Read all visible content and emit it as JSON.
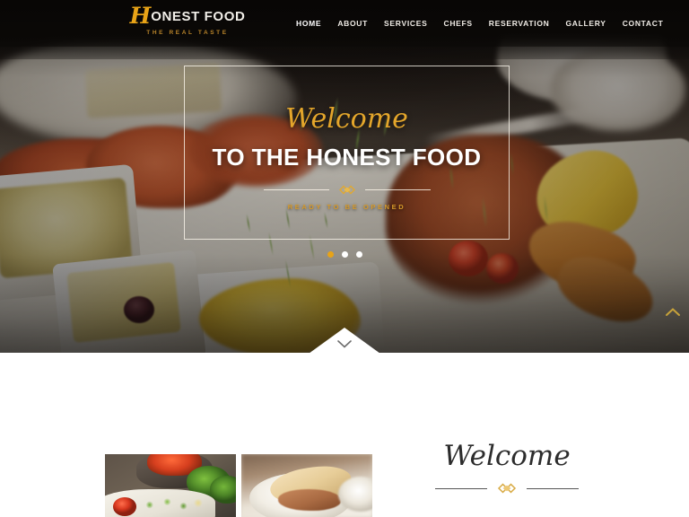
{
  "site": {
    "brand_initial": "H",
    "brand_rest": "ONEST FOOD",
    "brand_tagline": "THE REAL TASTE"
  },
  "nav": {
    "items": [
      {
        "label": "HOME",
        "active": true
      },
      {
        "label": "ABOUT",
        "active": false
      },
      {
        "label": "SERVICES",
        "active": false
      },
      {
        "label": "CHEFS",
        "active": false
      },
      {
        "label": "RESERVATION",
        "active": false
      },
      {
        "label": "GALLERY",
        "active": false
      },
      {
        "label": "CONTACT",
        "active": false
      }
    ]
  },
  "hero": {
    "script_text": "Welcome",
    "title": "TO THE HONEST FOOD",
    "subtitle": "READY TO BE OPENED",
    "slider_dots": 3,
    "active_dot": 1,
    "scroll_icon": "chevron-down-icon",
    "back_to_top_icon": "chevron-up-icon",
    "ornament_icon": "diamond-ornament-icon"
  },
  "welcome_section": {
    "heading": "Welcome",
    "ornament_icon": "diamond-ornament-icon",
    "images": [
      {
        "alt": "broccoli-tomato-salad-photo"
      },
      {
        "alt": "sandwich-on-plate-photo"
      }
    ]
  },
  "colors": {
    "gold": "#e8a317",
    "gold_dark": "#b9842a",
    "header_bg": "#0a0805",
    "white": "#ffffff",
    "text_dark": "#2c2c2c"
  }
}
